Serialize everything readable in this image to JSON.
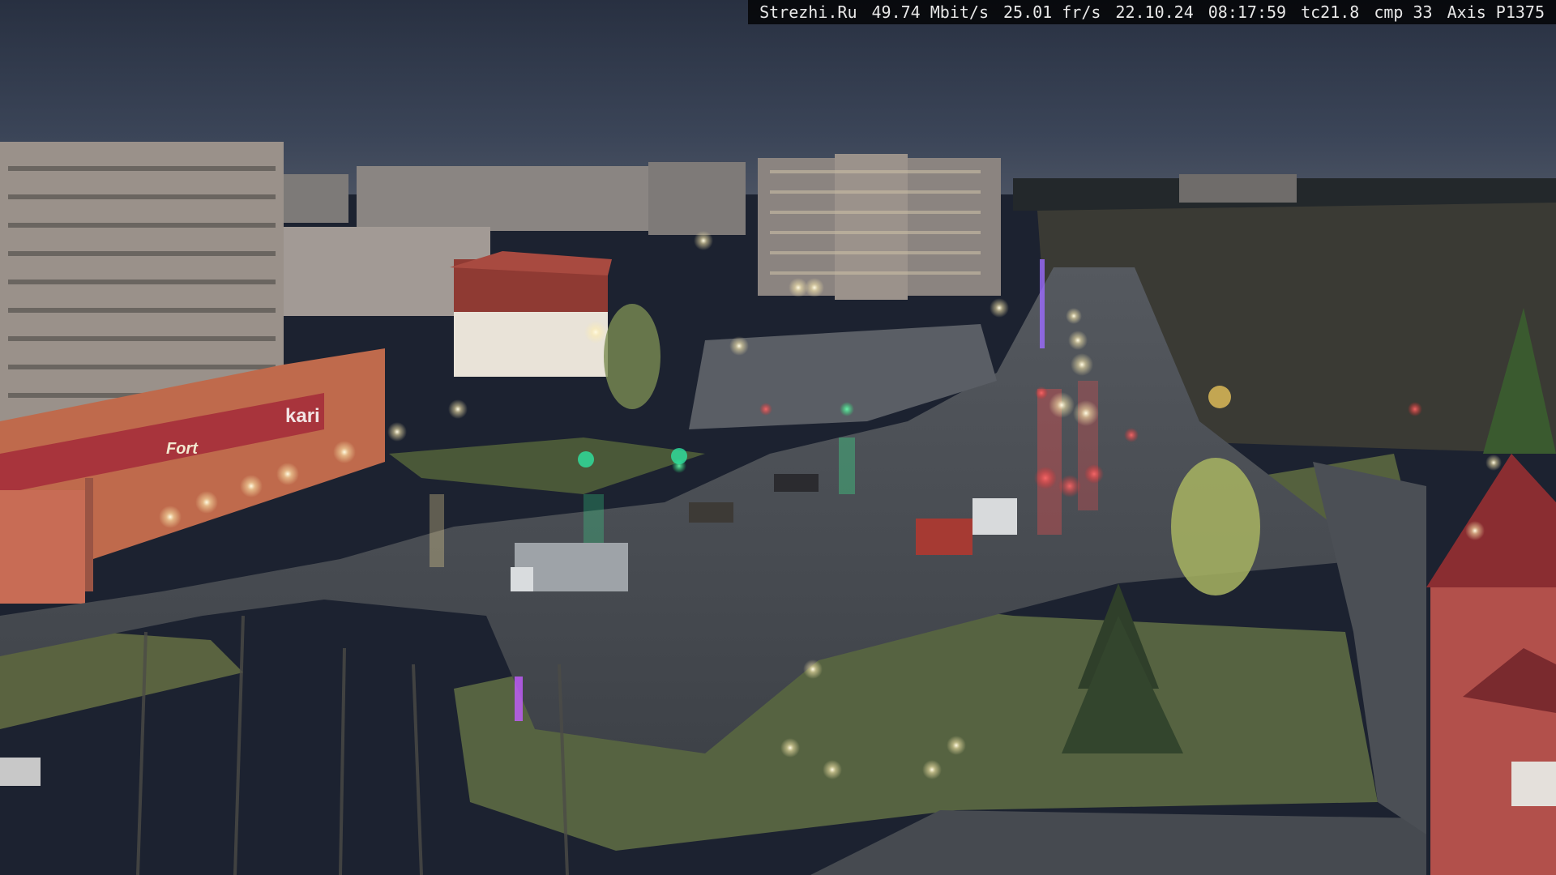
{
  "overlay": {
    "site": "Strezhi.Ru",
    "bitrate": "49.74 Mbit/s",
    "framerate": "25.01 fr/s",
    "date": "22.10.24",
    "time": "08:17:59",
    "tc": "tc21.8",
    "cmp": "cmp 33",
    "camera": "Axis P1375"
  },
  "signs": {
    "store_main": "kari",
    "store_secondary": "Fort"
  },
  "colors": {
    "sky": "#2b3446",
    "asphalt": "#4c525a",
    "grass": "#4f5c3c",
    "building_brick": "#b7624a",
    "streetlight": "#f4f0d8",
    "tail_light": "#ff3b3b"
  }
}
